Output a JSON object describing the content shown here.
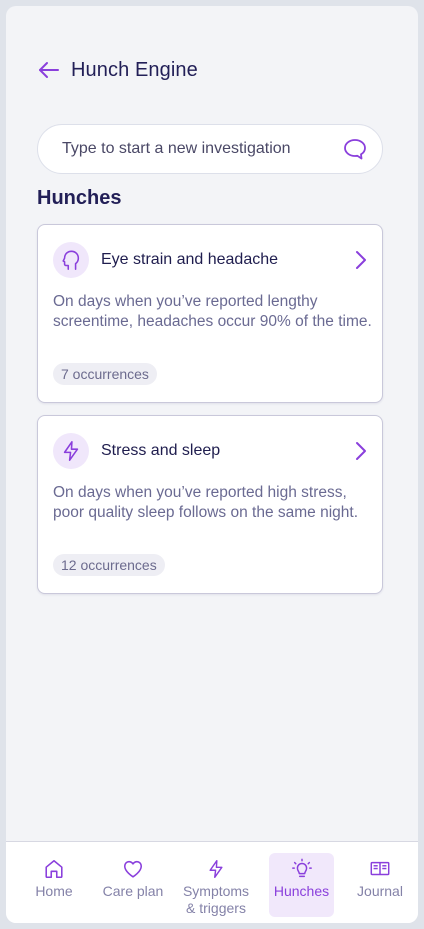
{
  "header": {
    "title": "Hunch Engine",
    "back_icon": "arrow-left-icon"
  },
  "search": {
    "placeholder": "Type to start a new investigation",
    "value": "",
    "icon": "chat-bubble-icon"
  },
  "section": {
    "title": "Hunches"
  },
  "hunches": [
    {
      "icon": "head-profile-icon",
      "title": "Eye strain and headache",
      "description": "On days when you’ve reported lengthy screentime, headaches occur 90% of the time.",
      "occurrences": "7 occurrences"
    },
    {
      "icon": "lightning-icon",
      "title": "Stress and sleep",
      "description": "On days when you’ve reported high stress, poor quality sleep follows on the same night.",
      "occurrences": "12 occurrences"
    }
  ],
  "tabs": [
    {
      "label": "Home",
      "icon": "home-icon",
      "active": false
    },
    {
      "label": "Care plan",
      "icon": "heart-icon",
      "active": false
    },
    {
      "label": "Symptoms\n& triggers",
      "icon": "lightning-icon",
      "active": false
    },
    {
      "label": "Hunches",
      "icon": "lightbulb-icon",
      "active": true
    },
    {
      "label": "Journal",
      "icon": "book-icon",
      "active": false
    }
  ],
  "colors": {
    "accent": "#8a3fdc",
    "text": "#221f57",
    "muted": "#6a6a92",
    "background": "#f3f4f7"
  }
}
